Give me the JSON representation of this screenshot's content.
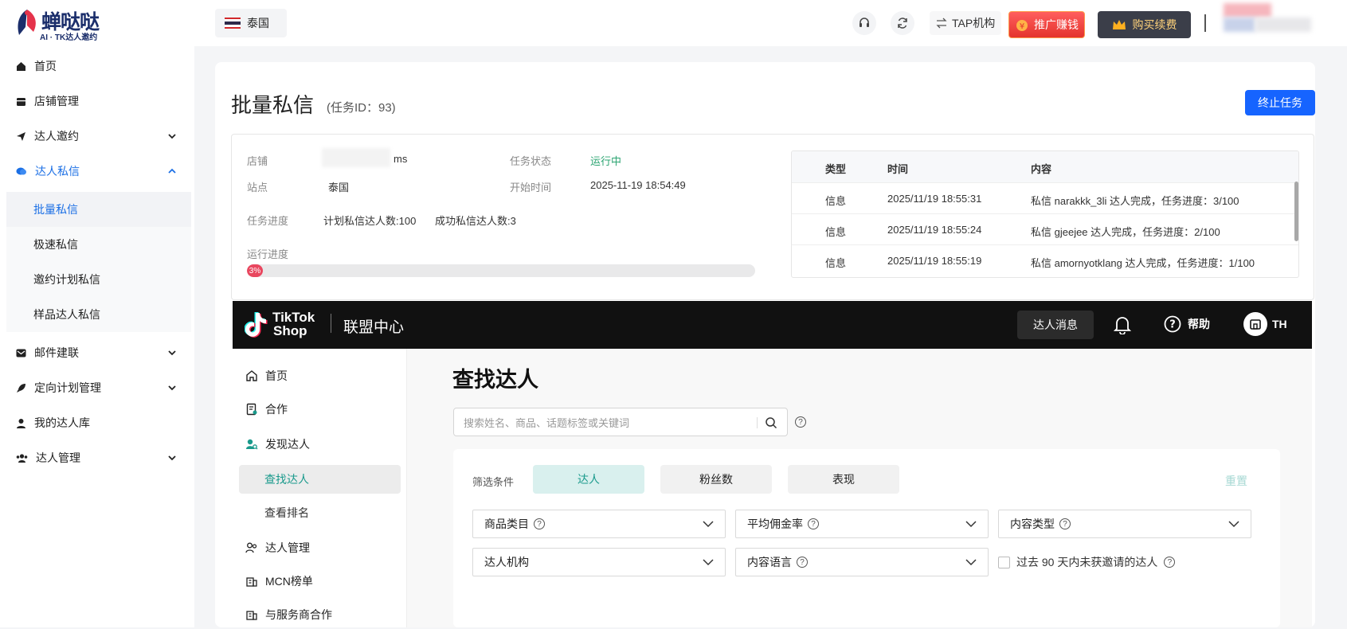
{
  "brand": {
    "name": "蝉哒哒",
    "tagline": "AI · TK达人邀约"
  },
  "topbar": {
    "country": "泰国",
    "tap_label": "TAP机构",
    "promo_label": "推广赚钱",
    "buy_label": "购买续费"
  },
  "sidebar": {
    "items": [
      {
        "label": "首页",
        "icon": "home-icon"
      },
      {
        "label": "店铺管理",
        "icon": "store-icon"
      },
      {
        "label": "达人邀约",
        "icon": "send-icon",
        "expandable": true
      },
      {
        "label": "达人私信",
        "icon": "chat-icon",
        "expanded": true,
        "active": true
      },
      {
        "label": "邮件建联",
        "icon": "mail-icon",
        "expandable": true
      },
      {
        "label": "定向计划管理",
        "icon": "rocket-icon",
        "expandable": true
      },
      {
        "label": "我的达人库",
        "icon": "user-icon"
      },
      {
        "label": "达人管理",
        "icon": "users-icon",
        "expandable": true
      }
    ],
    "subitems": [
      "批量私信",
      "极速私信",
      "邀约计划私信",
      "样品达人私信"
    ],
    "active_subitem": "批量私信"
  },
  "page": {
    "title": "批量私信",
    "task_id": "(任务ID：93)",
    "stop_button": "终止任务"
  },
  "task": {
    "store_label": "店铺",
    "store_value": "ms",
    "site_label": "站点",
    "site_value": "泰国",
    "status_label": "任务状态",
    "status_value": "运行中",
    "start_label": "开始时间",
    "start_value": "2025-11-19 18:54:49",
    "progress_label": "任务进度",
    "planned": "计划私信达人数:100",
    "succeeded": "成功私信达人数:3",
    "run_label": "运行进度",
    "run_percent_text": "3%",
    "run_fraction": 0.03,
    "status_color": "#2ba471"
  },
  "log": {
    "headers": [
      "类型",
      "时间",
      "内容"
    ],
    "rows": [
      {
        "type": "信息",
        "time": "2025/11/19 18:55:31",
        "content": "私信 narakkk_3li 达人完成，任务进度：3/100"
      },
      {
        "type": "信息",
        "time": "2025/11/19 18:55:24",
        "content": "私信 gjeejee 达人完成，任务进度：2/100"
      },
      {
        "type": "信息",
        "time": "2025/11/19 18:55:19",
        "content": "私信 amornyotklang 达人完成，任务进度：1/100"
      }
    ]
  },
  "tiktok": {
    "logo_line1": "TikTok",
    "logo_line2": "Shop",
    "center": "联盟中心",
    "messages_btn": "达人消息",
    "help": "帮助",
    "region": "TH",
    "nav": [
      {
        "label": "首页",
        "icon": "home-outline-icon"
      },
      {
        "label": "合作",
        "icon": "document-icon"
      },
      {
        "label": "发现达人",
        "icon": "find-creator-icon"
      }
    ],
    "nav_sub": [
      "查找达人",
      "查看排名"
    ],
    "nav2": [
      {
        "label": "达人管理",
        "icon": "people-icon"
      },
      {
        "label": "MCN榜单",
        "icon": "building-icon"
      },
      {
        "label": "与服务商合作",
        "icon": "building-icon"
      }
    ],
    "title": "查找达人",
    "search_placeholder": "搜索姓名、商品、话题标签或关键词",
    "filter_label": "筛选条件",
    "chips": [
      "达人",
      "粉丝数",
      "表现"
    ],
    "reset": "重置",
    "dropdowns": [
      "商品类目",
      "平均佣金率",
      "内容类型",
      "达人机构",
      "内容语言"
    ],
    "checkbox_label": "过去 90 天内未获邀请的达人"
  }
}
